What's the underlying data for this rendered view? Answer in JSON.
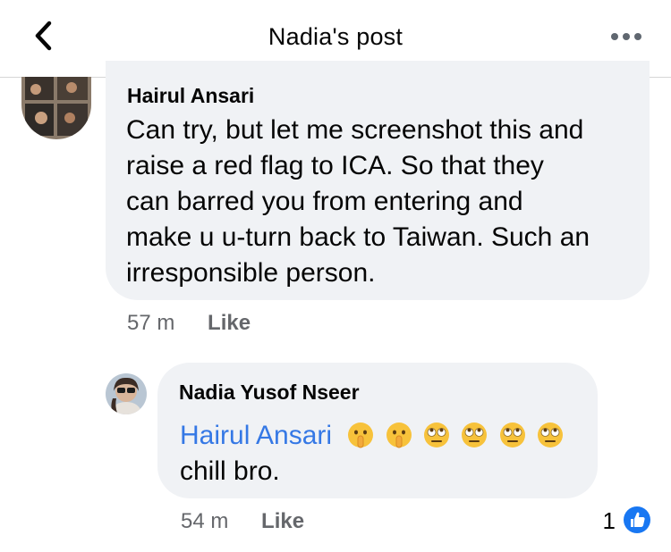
{
  "header": {
    "title": "Nadia's post"
  },
  "comments": [
    {
      "author": "Hairul Ansari",
      "text_lines": [
        "Can try, but let me screenshot this and",
        "raise a red flag to ICA. So that they",
        "can barred you from entering and",
        "make u u-turn back to Taiwan. Such an",
        "irresponsible person."
      ],
      "time": "57 m",
      "like_label": "Like"
    },
    {
      "author": "Nadia Yusof Nseer",
      "mention": "Hairul Ansari",
      "emojis": [
        "shushing-face",
        "shushing-face",
        "eye-roll-face",
        "eye-roll-face",
        "eye-roll-face",
        "eye-roll-face"
      ],
      "text": "chill bro.",
      "time": "54 m",
      "like_label": "Like",
      "reaction_count": "1",
      "reaction_icon": "thumbs-up-icon"
    }
  ],
  "colors": {
    "accent": "#1877f2",
    "mention": "#3578e5",
    "bubble": "#f0f2f5",
    "meta": "#65676b"
  }
}
